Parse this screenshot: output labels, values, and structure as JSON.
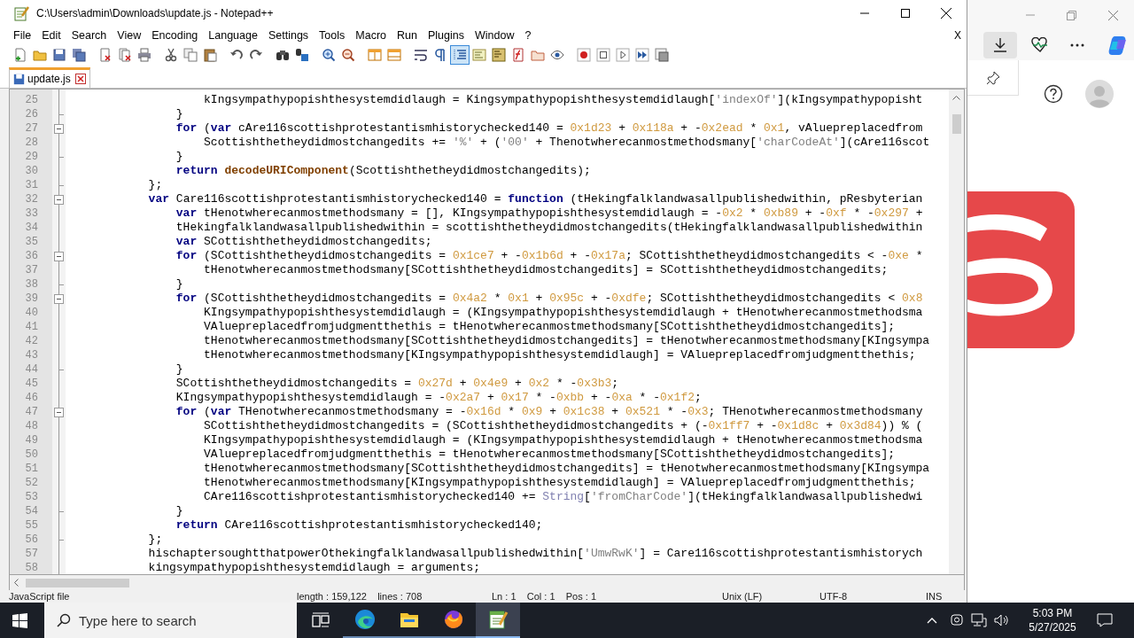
{
  "window": {
    "title": "C:\\Users\\admin\\Downloads\\update.js - Notepad++"
  },
  "menu": [
    "File",
    "Edit",
    "Search",
    "View",
    "Encoding",
    "Language",
    "Settings",
    "Tools",
    "Macro",
    "Run",
    "Plugins",
    "Window",
    "?"
  ],
  "menu_close": "X",
  "toolbar": [
    {
      "on": false
    },
    {
      "on": false
    },
    {
      "on": false
    },
    {
      "on": false
    },
    {
      "on": false
    },
    {
      "on": false
    },
    {
      "on": false
    },
    {
      "on": false
    },
    {
      "on": false
    },
    {
      "on": false
    },
    {
      "on": false
    },
    {
      "on": false
    },
    {
      "on": false
    },
    {
      "on": false
    },
    {
      "on": false
    },
    {
      "on": false
    },
    {
      "on": false
    },
    {
      "on": false
    },
    {
      "on": false
    },
    {
      "on": false
    },
    {
      "on": true
    },
    {
      "on": false
    },
    {
      "on": false
    },
    {
      "on": false
    },
    {
      "on": false
    },
    {
      "on": false
    },
    {
      "on": false
    },
    {
      "on": false
    },
    {
      "on": false
    },
    {
      "on": false
    },
    {
      "on": false
    }
  ],
  "tabs": [
    {
      "label": "update.js",
      "selected": true
    }
  ],
  "editor": {
    "lines": [
      {
        "number": "25",
        "tokens": [
          {
            "kind": "plain",
            "text": "                    kIngsympathypopishthesystemdidlaugh = Kingsympathypopishthesystemdidlaugh["
          },
          {
            "kind": "string",
            "text": "'indexOf'"
          },
          {
            "kind": "plain",
            "text": "](kIngsympathypopisht"
          }
        ]
      },
      {
        "number": "26",
        "kind": "fold_end",
        "tokens": [
          {
            "kind": "plain",
            "text": "                }"
          }
        ]
      },
      {
        "number": "27",
        "kind": "fold_start",
        "tokens": [
          {
            "kind": "keyword",
            "text": "                for"
          },
          {
            "kind": "plain",
            "text": " ("
          },
          {
            "kind": "keyword",
            "text": "var"
          },
          {
            "kind": "plain",
            "text": " cAre116scottishprotestantismhistorychecked140 = "
          },
          {
            "kind": "number",
            "text": "0x1d23"
          },
          {
            "kind": "plain",
            "text": " + "
          },
          {
            "kind": "number",
            "text": "0x118a"
          },
          {
            "kind": "plain",
            "text": " + -"
          },
          {
            "kind": "number",
            "text": "0x2ead"
          },
          {
            "kind": "plain",
            "text": " * "
          },
          {
            "kind": "number",
            "text": "0x1"
          },
          {
            "kind": "plain",
            "text": ", vAluepreplacedfrom"
          }
        ]
      },
      {
        "number": "28",
        "tokens": [
          {
            "kind": "plain",
            "text": "                    Scottishthetheydidmostchangedits += "
          },
          {
            "kind": "string",
            "text": "'%'"
          },
          {
            "kind": "plain",
            "text": " + ("
          },
          {
            "kind": "string",
            "text": "'00'"
          },
          {
            "kind": "plain",
            "text": " + Thenotwherecanmostmethodsmany["
          },
          {
            "kind": "string",
            "text": "'charCodeAt'"
          },
          {
            "kind": "plain",
            "text": "](cAre116scot"
          }
        ]
      },
      {
        "number": "29",
        "kind": "fold_end",
        "tokens": [
          {
            "kind": "plain",
            "text": "                }"
          }
        ]
      },
      {
        "number": "30",
        "tokens": [
          {
            "kind": "keyword",
            "text": "                return "
          },
          {
            "kind": "builtin",
            "text": "decodeURIComponent"
          },
          {
            "kind": "plain",
            "text": "(Scottishthetheydidmostchangedits);"
          }
        ]
      },
      {
        "number": "31",
        "kind": "fold_end",
        "tokens": [
          {
            "kind": "plain",
            "text": "            };"
          }
        ]
      },
      {
        "number": "32",
        "kind": "fold_start",
        "tokens": [
          {
            "kind": "keyword",
            "text": "            var"
          },
          {
            "kind": "plain",
            "text": " Care116scottishprotestantismhistorychecked140 = "
          },
          {
            "kind": "keyword",
            "text": "function"
          },
          {
            "kind": "plain",
            "text": " (tHekingfalklandwasallpublishedwithin, pResbyterian"
          }
        ]
      },
      {
        "number": "33",
        "tokens": [
          {
            "kind": "keyword",
            "text": "                var"
          },
          {
            "kind": "plain",
            "text": " tHenotwherecanmostmethodsmany = [], KIngsympathypopishthesystemdidlaugh = -"
          },
          {
            "kind": "number",
            "text": "0x2"
          },
          {
            "kind": "plain",
            "text": " * "
          },
          {
            "kind": "number",
            "text": "0xb89"
          },
          {
            "kind": "plain",
            "text": " + -"
          },
          {
            "kind": "number",
            "text": "0xf"
          },
          {
            "kind": "plain",
            "text": " * -"
          },
          {
            "kind": "number",
            "text": "0x297"
          },
          {
            "kind": "plain",
            "text": " +"
          }
        ]
      },
      {
        "number": "34",
        "tokens": [
          {
            "kind": "plain",
            "text": "                tHekingfalklandwasallpublishedwithin = scottishthetheydidmostchangedits(tHekingfalklandwasallpublishedwithin"
          }
        ]
      },
      {
        "number": "35",
        "tokens": [
          {
            "kind": "keyword",
            "text": "                var"
          },
          {
            "kind": "plain",
            "text": " SCottishthetheydidmostchangedits;"
          }
        ]
      },
      {
        "number": "36",
        "kind": "fold_start",
        "tokens": [
          {
            "kind": "keyword",
            "text": "                for"
          },
          {
            "kind": "plain",
            "text": " (SCottishthetheydidmostchangedits = "
          },
          {
            "kind": "number",
            "text": "0x1ce7"
          },
          {
            "kind": "plain",
            "text": " + -"
          },
          {
            "kind": "number",
            "text": "0x1b6d"
          },
          {
            "kind": "plain",
            "text": " + -"
          },
          {
            "kind": "number",
            "text": "0x17a"
          },
          {
            "kind": "plain",
            "text": "; SCottishthetheydidmostchangedits < -"
          },
          {
            "kind": "number",
            "text": "0xe"
          },
          {
            "kind": "plain",
            "text": " *"
          }
        ]
      },
      {
        "number": "37",
        "tokens": [
          {
            "kind": "plain",
            "text": "                    tHenotwherecanmostmethodsmany[SCottishthetheydidmostchangedits] = SCottishthetheydidmostchangedits;"
          }
        ]
      },
      {
        "number": "38",
        "kind": "fold_end",
        "tokens": [
          {
            "kind": "plain",
            "text": "                }"
          }
        ]
      },
      {
        "number": "39",
        "kind": "fold_start",
        "tokens": [
          {
            "kind": "keyword",
            "text": "                for"
          },
          {
            "kind": "plain",
            "text": " (SCottishthetheydidmostchangedits = "
          },
          {
            "kind": "number",
            "text": "0x4a2"
          },
          {
            "kind": "plain",
            "text": " * "
          },
          {
            "kind": "number",
            "text": "0x1"
          },
          {
            "kind": "plain",
            "text": " + "
          },
          {
            "kind": "number",
            "text": "0x95c"
          },
          {
            "kind": "plain",
            "text": " + -"
          },
          {
            "kind": "number",
            "text": "0xdfe"
          },
          {
            "kind": "plain",
            "text": "; SCottishthetheydidmostchangedits < "
          },
          {
            "kind": "number",
            "text": "0x8"
          }
        ]
      },
      {
        "number": "40",
        "tokens": [
          {
            "kind": "plain",
            "text": "                    KIngsympathypopishthesystemdidlaugh = (KIngsympathypopishthesystemdidlaugh + tHenotwherecanmostmethodsma"
          }
        ]
      },
      {
        "number": "41",
        "tokens": [
          {
            "kind": "plain",
            "text": "                    VAluepreplacedfromjudgmentthethis = tHenotwherecanmostmethodsmany[SCottishthetheydidmostchangedits];"
          }
        ]
      },
      {
        "number": "42",
        "tokens": [
          {
            "kind": "plain",
            "text": "                    tHenotwherecanmostmethodsmany[SCottishthetheydidmostchangedits] = tHenotwherecanmostmethodsmany[KIngsympa"
          }
        ]
      },
      {
        "number": "43",
        "tokens": [
          {
            "kind": "plain",
            "text": "                    tHenotwherecanmostmethodsmany[KIngsympathypopishthesystemdidlaugh] = VAluepreplacedfromjudgmentthethis;"
          }
        ]
      },
      {
        "number": "44",
        "kind": "fold_end",
        "tokens": [
          {
            "kind": "plain",
            "text": "                }"
          }
        ]
      },
      {
        "number": "45",
        "tokens": [
          {
            "kind": "plain",
            "text": "                SCottishthetheydidmostchangedits = "
          },
          {
            "kind": "number",
            "text": "0x27d"
          },
          {
            "kind": "plain",
            "text": " + "
          },
          {
            "kind": "number",
            "text": "0x4e9"
          },
          {
            "kind": "plain",
            "text": " + "
          },
          {
            "kind": "number",
            "text": "0x2"
          },
          {
            "kind": "plain",
            "text": " * -"
          },
          {
            "kind": "number",
            "text": "0x3b3"
          },
          {
            "kind": "plain",
            "text": ";"
          }
        ]
      },
      {
        "number": "46",
        "tokens": [
          {
            "kind": "plain",
            "text": "                KIngsympathypopishthesystemdidlaugh = -"
          },
          {
            "kind": "number",
            "text": "0x2a7"
          },
          {
            "kind": "plain",
            "text": " + "
          },
          {
            "kind": "number",
            "text": "0x17"
          },
          {
            "kind": "plain",
            "text": " * -"
          },
          {
            "kind": "number",
            "text": "0xbb"
          },
          {
            "kind": "plain",
            "text": " + -"
          },
          {
            "kind": "number",
            "text": "0xa"
          },
          {
            "kind": "plain",
            "text": " * -"
          },
          {
            "kind": "number",
            "text": "0x1f2"
          },
          {
            "kind": "plain",
            "text": ";"
          }
        ]
      },
      {
        "number": "47",
        "kind": "fold_start",
        "tokens": [
          {
            "kind": "keyword",
            "text": "                for"
          },
          {
            "kind": "plain",
            "text": " ("
          },
          {
            "kind": "keyword",
            "text": "var"
          },
          {
            "kind": "plain",
            "text": " THenotwherecanmostmethodsmany = -"
          },
          {
            "kind": "number",
            "text": "0x16d"
          },
          {
            "kind": "plain",
            "text": " * "
          },
          {
            "kind": "number",
            "text": "0x9"
          },
          {
            "kind": "plain",
            "text": " + "
          },
          {
            "kind": "number",
            "text": "0x1c38"
          },
          {
            "kind": "plain",
            "text": " + "
          },
          {
            "kind": "number",
            "text": "0x521"
          },
          {
            "kind": "plain",
            "text": " * -"
          },
          {
            "kind": "number",
            "text": "0x3"
          },
          {
            "kind": "plain",
            "text": "; THenotwherecanmostmethodsmany"
          }
        ]
      },
      {
        "number": "48",
        "tokens": [
          {
            "kind": "plain",
            "text": "                    SCottishthetheydidmostchangedits = (SCottishthetheydidmostchangedits + (-"
          },
          {
            "kind": "number",
            "text": "0x1ff7"
          },
          {
            "kind": "plain",
            "text": " + -"
          },
          {
            "kind": "number",
            "text": "0x1d8c"
          },
          {
            "kind": "plain",
            "text": " + "
          },
          {
            "kind": "number",
            "text": "0x3d84"
          },
          {
            "kind": "plain",
            "text": ")) % ("
          }
        ]
      },
      {
        "number": "49",
        "tokens": [
          {
            "kind": "plain",
            "text": "                    KIngsympathypopishthesystemdidlaugh = (KIngsympathypopishthesystemdidlaugh + tHenotwherecanmostmethodsma"
          }
        ]
      },
      {
        "number": "50",
        "tokens": [
          {
            "kind": "plain",
            "text": "                    VAluepreplacedfromjudgmentthethis = tHenotwherecanmostmethodsmany[SCottishthetheydidmostchangedits];"
          }
        ]
      },
      {
        "number": "51",
        "tokens": [
          {
            "kind": "plain",
            "text": "                    tHenotwherecanmostmethodsmany[SCottishthetheydidmostchangedits] = tHenotwherecanmostmethodsmany[KIngsympa"
          }
        ]
      },
      {
        "number": "52",
        "tokens": [
          {
            "kind": "plain",
            "text": "                    tHenotwherecanmostmethodsmany[KIngsympathypopishthesystemdidlaugh] = VAluepreplacedfromjudgmentthethis;"
          }
        ]
      },
      {
        "number": "53",
        "tokens": [
          {
            "kind": "plain",
            "text": "                    CAre116scottishprotestantismhistorychecked140 += "
          },
          {
            "kind": "class",
            "text": "String"
          },
          {
            "kind": "plain",
            "text": "["
          },
          {
            "kind": "string",
            "text": "'fromCharCode'"
          },
          {
            "kind": "plain",
            "text": "](tHekingfalklandwasallpublishedwi"
          }
        ]
      },
      {
        "number": "54",
        "kind": "fold_end",
        "tokens": [
          {
            "kind": "plain",
            "text": "                }"
          }
        ]
      },
      {
        "number": "55",
        "tokens": [
          {
            "kind": "keyword",
            "text": "                return"
          },
          {
            "kind": "plain",
            "text": " CAre116scottishprotestantismhistorychecked140;"
          }
        ]
      },
      {
        "number": "56",
        "kind": "fold_end",
        "tokens": [
          {
            "kind": "plain",
            "text": "            };"
          }
        ]
      },
      {
        "number": "57",
        "tokens": [
          {
            "kind": "plain",
            "text": "            hischaptersoughtthatpowerOthekingfalklandwasallpublishedwithin["
          },
          {
            "kind": "string",
            "text": "'UmwRwK'"
          },
          {
            "kind": "plain",
            "text": "] = Care116scottishprotestantismhistorych"
          }
        ]
      },
      {
        "number": "58",
        "tokens": [
          {
            "kind": "plain",
            "text": "            kingsympathypopishthesystemdidlaugh = arguments;"
          }
        ]
      }
    ]
  },
  "status_bar": [
    "JavaScript file",
    "length : 159,122    lines : 708",
    "Ln : 1    Col : 1    Pos : 1",
    "Unix (LF)",
    "UTF-8",
    "INS"
  ],
  "taskbar": {
    "search": {
      "placeholder": "Type here to search"
    },
    "apps": [
      {
        "selected": false
      },
      {
        "selected": false
      },
      {
        "selected": false
      },
      {
        "selected": true
      }
    ],
    "time": "5:03 PM",
    "date": "5/27/2025"
  }
}
